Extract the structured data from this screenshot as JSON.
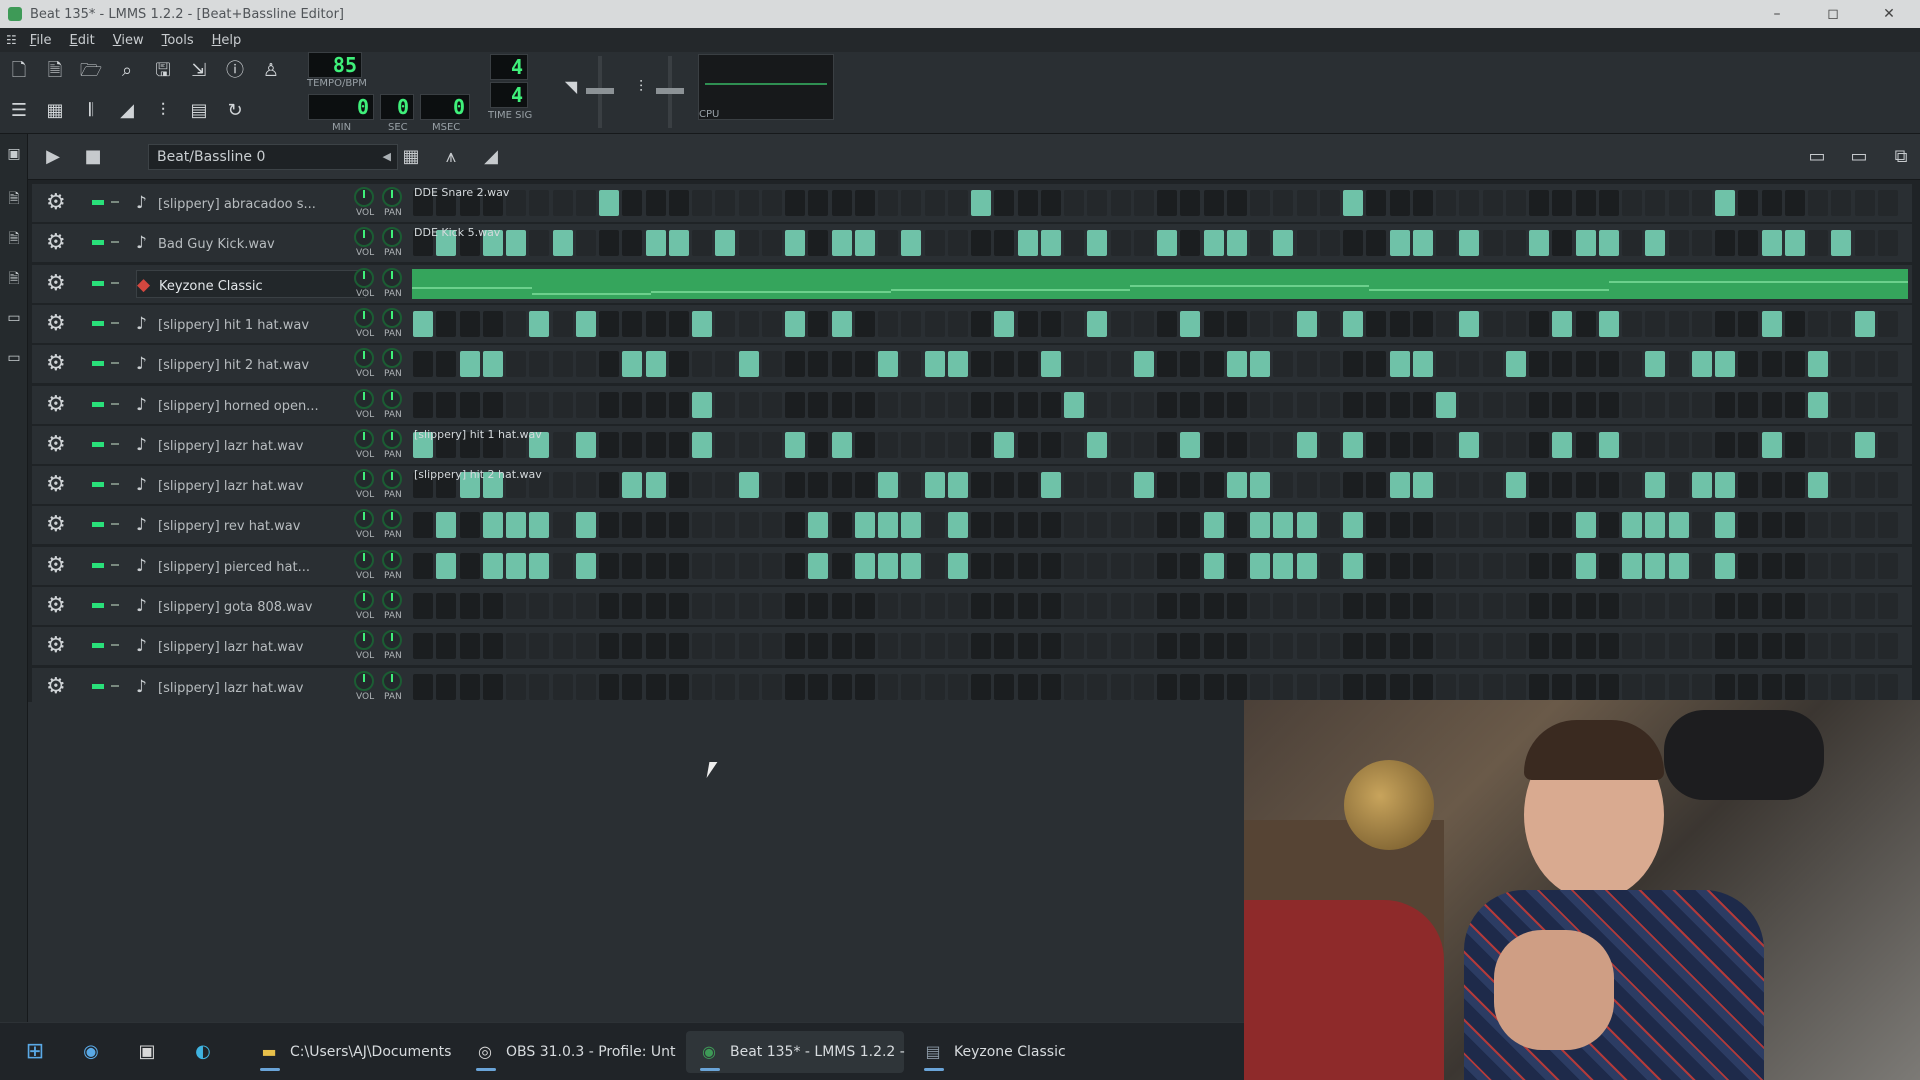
{
  "window": {
    "title": "Beat 135* - LMMS 1.2.2 - [Beat+Bassline Editor]"
  },
  "menu": [
    "File",
    "Edit",
    "View",
    "Tools",
    "Help"
  ],
  "transport": {
    "tempo": "85",
    "tempo_label": "TEMPO/BPM",
    "min": "0",
    "sec": "0",
    "msec": "0",
    "min_label": "MIN",
    "sec_label": "SEC",
    "msec_label": "MSEC",
    "timesig_num": "4",
    "timesig_den": "4",
    "timesig_label": "TIME SIG",
    "cpu_label": "CPU"
  },
  "bb_editor": {
    "selected_pattern": "Beat/Bassline 0"
  },
  "knob_labels": {
    "vol": "VOL",
    "pan": "PAN"
  },
  "tracks": [
    {
      "name": "[slippery] abracadoo s...",
      "type": "sample",
      "clip_label": "DDE Snare 2.wav",
      "steps": [
        8,
        24,
        40,
        56
      ]
    },
    {
      "name": "Bad Guy Kick.wav",
      "type": "sample",
      "clip_label": "DDE Kick 5.wav",
      "steps": [
        1,
        3,
        4,
        6,
        10,
        11,
        13,
        16,
        18,
        19,
        21,
        26,
        27,
        29,
        32,
        34,
        35,
        37,
        42,
        43,
        45,
        48,
        50,
        51,
        53,
        58,
        59,
        61
      ]
    },
    {
      "name": "Keyzone Classic",
      "type": "instrument",
      "selected": true,
      "clip_label": "",
      "steps": []
    },
    {
      "name": "[slippery] hit 1 hat.wav",
      "type": "sample",
      "clip_label": "",
      "steps": [
        0,
        5,
        7,
        12,
        16,
        18,
        25,
        29,
        33,
        38,
        40,
        45,
        49,
        51,
        58,
        62
      ]
    },
    {
      "name": "[slippery] hit 2 hat.wav",
      "type": "sample",
      "clip_label": "",
      "steps": [
        2,
        3,
        9,
        10,
        14,
        20,
        22,
        23,
        27,
        31,
        35,
        36,
        42,
        43,
        47,
        53,
        55,
        56,
        60
      ]
    },
    {
      "name": "[slippery] horned open...",
      "type": "sample",
      "clip_label": "",
      "steps": [
        12,
        28,
        44,
        60
      ]
    },
    {
      "name": "[slippery] lazr hat.wav",
      "type": "sample",
      "clip_label": "[slippery] hit 1 hat.wav",
      "steps": [
        0,
        5,
        7,
        12,
        16,
        18,
        25,
        29,
        33,
        38,
        40,
        45,
        49,
        51,
        58,
        62
      ]
    },
    {
      "name": "[slippery] lazr hat.wav",
      "type": "sample",
      "clip_label": "[slippery] hit 2 hat.wav",
      "steps": [
        2,
        3,
        9,
        10,
        14,
        20,
        22,
        23,
        27,
        31,
        35,
        36,
        42,
        43,
        47,
        53,
        55,
        56,
        60
      ]
    },
    {
      "name": "[slippery] rev hat.wav",
      "type": "sample",
      "clip_label": "",
      "steps": [
        1,
        3,
        4,
        5,
        7,
        17,
        19,
        20,
        21,
        23,
        34,
        36,
        37,
        38,
        40,
        50,
        52,
        53,
        54,
        56
      ]
    },
    {
      "name": "[slippery] pierced hat...",
      "type": "sample",
      "clip_label": "",
      "steps": [
        1,
        3,
        4,
        5,
        7,
        17,
        19,
        20,
        21,
        23,
        34,
        36,
        37,
        38,
        40,
        50,
        52,
        53,
        54,
        56
      ]
    },
    {
      "name": "[slippery] gota 808.wav",
      "type": "sample",
      "clip_label": "",
      "steps": []
    },
    {
      "name": "[slippery] lazr hat.wav",
      "type": "sample",
      "clip_label": "",
      "steps": []
    },
    {
      "name": "[slippery] lazr hat.wav",
      "type": "sample",
      "clip_label": "",
      "steps": []
    }
  ],
  "taskbar": {
    "items": [
      {
        "label": "C:\\Users\\AJ\\Documents",
        "icon": "folder-icon"
      },
      {
        "label": "OBS 31.0.3 - Profile: Unt",
        "icon": "obs-icon"
      },
      {
        "label": "Beat 135* - LMMS 1.2.2 -",
        "icon": "lmms-icon",
        "active": true
      },
      {
        "label": "Keyzone Classic",
        "icon": "window-icon"
      }
    ]
  },
  "colors": {
    "accent": "#35a55c",
    "step_on": "#6fc2a8",
    "lcd": "#3ff07a"
  }
}
